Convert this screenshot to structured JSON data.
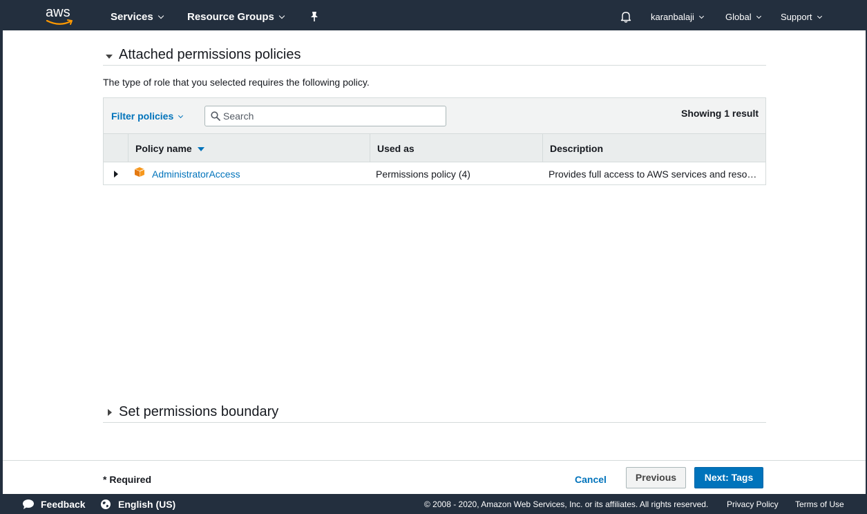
{
  "topnav": {
    "logo_text": "aws",
    "services_label": "Services",
    "resource_groups_label": "Resource Groups",
    "user_label": "karanbalaji",
    "region_label": "Global",
    "support_label": "Support"
  },
  "attached": {
    "title": "Attached permissions policies",
    "description": "The type of role that you selected requires the following policy.",
    "filter_label": "Filter policies",
    "search_placeholder": "Search",
    "showing_text": "Showing 1 result",
    "columns": {
      "policy_name": "Policy name",
      "used_as": "Used as",
      "description": "Description"
    },
    "rows": [
      {
        "policy_name": "AdministratorAccess",
        "used_as": "Permissions policy (4)",
        "description": "Provides full access to AWS services and reso…"
      }
    ]
  },
  "boundary": {
    "title": "Set permissions boundary"
  },
  "actions": {
    "required_text": "* Required",
    "cancel_label": "Cancel",
    "previous_label": "Previous",
    "next_label": "Next: Tags"
  },
  "footer": {
    "feedback_label": "Feedback",
    "language_label": "English (US)",
    "copyright": "© 2008 - 2020, Amazon Web Services, Inc. or its affiliates. All rights reserved.",
    "privacy_label": "Privacy Policy",
    "terms_label": "Terms of Use"
  },
  "colors": {
    "nav_bg": "#232f3e",
    "link_blue": "#0073bb",
    "aws_orange": "#ff9900"
  }
}
